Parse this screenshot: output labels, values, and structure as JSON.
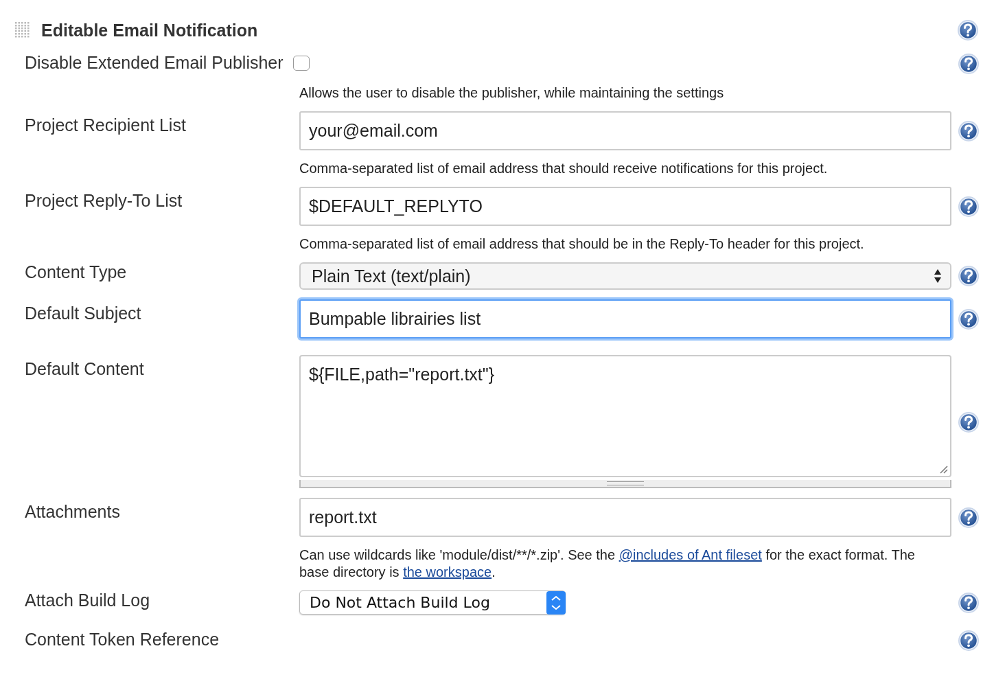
{
  "section": {
    "title": "Editable Email Notification"
  },
  "rows": [
    {
      "kind": "checkbox",
      "label": "Disable Extended Email Publisher",
      "checked": false,
      "description": [
        {
          "kind": "text",
          "text": "Allows the user to disable the publisher, while maintaining the settings"
        }
      ]
    },
    {
      "kind": "text",
      "label": "Project Recipient List",
      "value": "your@email.com",
      "focused": false,
      "description": [
        {
          "kind": "text",
          "text": "Comma-separated list of email address that should receive notifications for this project."
        }
      ]
    },
    {
      "kind": "text",
      "label": "Project Reply-To List",
      "value": "$DEFAULT_REPLYTO",
      "focused": false,
      "description": [
        {
          "kind": "text",
          "text": "Comma-separated list of email address that should be in the Reply-To header for this project."
        }
      ]
    },
    {
      "kind": "select",
      "label": "Content Type",
      "value": "Plain Text (text/plain)"
    },
    {
      "kind": "text",
      "label": "Default Subject",
      "value": "Bumpable librairies list",
      "focused": true
    },
    {
      "kind": "textarea",
      "label": "Default Content",
      "value": "${FILE,path=\"report.txt\"}"
    },
    {
      "kind": "text",
      "label": "Attachments",
      "value": "report.txt",
      "focused": false,
      "description": [
        {
          "kind": "text",
          "text": "Can use wildcards like 'module/dist/**/*.zip'. See the "
        },
        {
          "kind": "link",
          "text": "@includes of Ant fileset"
        },
        {
          "kind": "text",
          "text": " for the exact format. The base directory is "
        },
        {
          "kind": "link",
          "text": "the workspace"
        },
        {
          "kind": "text",
          "text": "."
        }
      ]
    },
    {
      "kind": "smallselect",
      "label": "Attach Build Log",
      "value": "Do Not Attach Build Log"
    },
    {
      "kind": "label",
      "label": "Content Token Reference"
    }
  ]
}
